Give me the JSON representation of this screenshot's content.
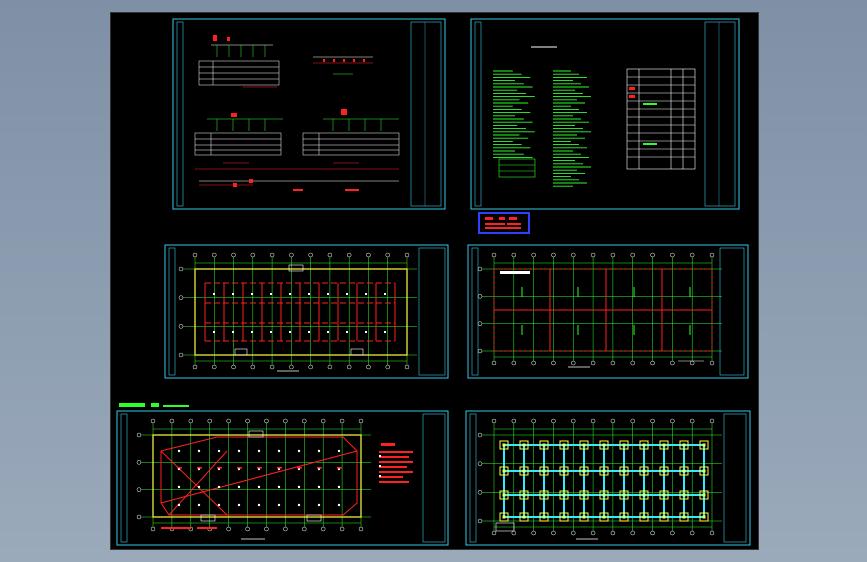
{
  "viewport": {
    "background_color": "#000000",
    "frame_color": "#35c8e8",
    "grid_color": "#2cff2c",
    "beam_color": "#ff2020",
    "column_color": "#ffff40",
    "text_color": "#ffffff",
    "legend_box_color": "#3040ff"
  },
  "sheets": [
    {
      "id": "sheet-1",
      "kind": "details"
    },
    {
      "id": "sheet-2",
      "kind": "general-notes"
    },
    {
      "id": "sheet-3",
      "kind": "floor-plan"
    },
    {
      "id": "sheet-4",
      "kind": "roof-plan"
    },
    {
      "id": "sheet-5",
      "kind": "roof-bracing-plan"
    },
    {
      "id": "sheet-6",
      "kind": "foundation-plan"
    }
  ]
}
